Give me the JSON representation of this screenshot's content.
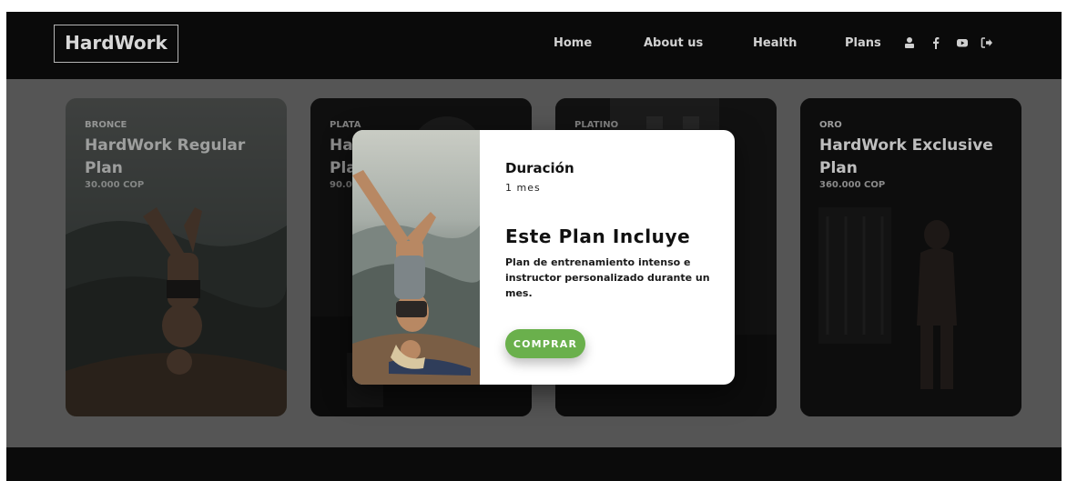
{
  "nav": {
    "logo": "HardWork",
    "links": [
      "Home",
      "About us",
      "Health",
      "Plans"
    ],
    "icons": [
      "user-icon",
      "facebook-icon",
      "youtube-icon",
      "logout-icon"
    ]
  },
  "cards": [
    {
      "tier": "BRONCE",
      "title": "HardWork Regular Plan",
      "price": "30.000 COP"
    },
    {
      "tier": "PLATA",
      "title": "Ha",
      "title_line2": "Pla",
      "price": "90.0"
    },
    {
      "tier": "PLATINO"
    },
    {
      "tier": "ORO",
      "title": "HardWork Exclusive Plan",
      "price": "360.000 COP"
    }
  ],
  "modal": {
    "duration_label": "Duración",
    "duration_value": "1 mes",
    "heading": "Este Plan Incluye",
    "description": "Plan de entrenamiento intenso e instructor personalizado durante un mes.",
    "buy_label": "COMPRAR"
  },
  "colors": {
    "navbar": "#0a0a0a",
    "buy_button": "#6ab04c",
    "overlay": "#555555"
  }
}
